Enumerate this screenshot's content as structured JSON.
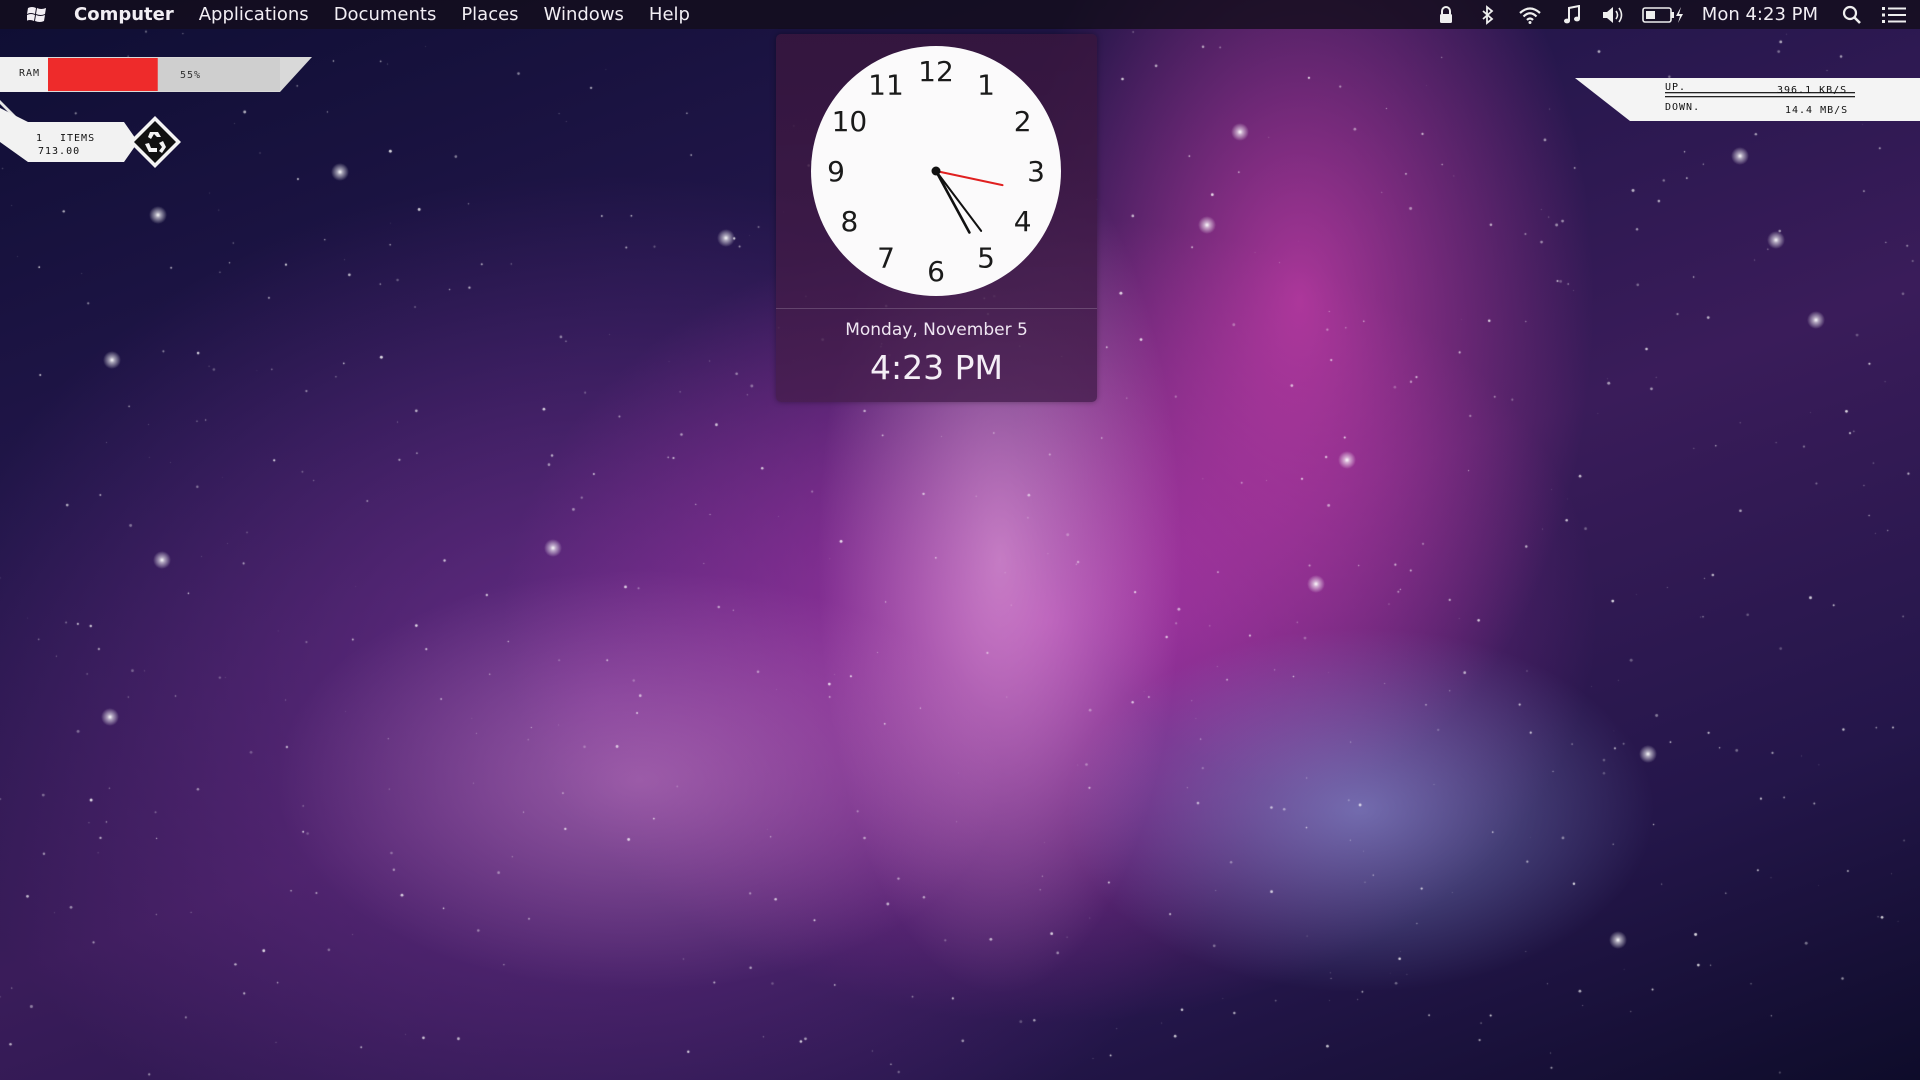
{
  "menubar": {
    "logo": "windows-logo",
    "items": [
      {
        "label": "Computer",
        "bold": true
      },
      {
        "label": "Applications",
        "bold": false
      },
      {
        "label": "Documents",
        "bold": false
      },
      {
        "label": "Places",
        "bold": false
      },
      {
        "label": "Windows",
        "bold": false
      },
      {
        "label": "Help",
        "bold": false
      }
    ],
    "tray_icons": [
      "lock-icon",
      "bluetooth-icon",
      "wifi-icon",
      "music-icon",
      "volume-icon",
      "battery-charging-icon"
    ],
    "clock": "Mon 4:23 PM",
    "right_icons": [
      "search-icon",
      "list-icon"
    ]
  },
  "ram_widget": {
    "label": "RAM",
    "percent_text": "55%",
    "usage": 55,
    "fill_color": "#ee2b2b"
  },
  "recycle_widget": {
    "count": "1",
    "items_label": "ITEMS",
    "size": "713.00",
    "icon": "recycle-icon"
  },
  "net_widget": {
    "up_label": "UP.",
    "up_value": "396.1 KB/S",
    "down_label": "DOWN.",
    "down_value": "14.4 MB/S"
  },
  "clock_widget": {
    "numbers": [
      "12",
      "1",
      "2",
      "3",
      "4",
      "5",
      "6",
      "7",
      "8",
      "9",
      "10",
      "11"
    ],
    "date": "Monday, November 5",
    "time": "4:23 PM",
    "hour": 4,
    "minute": 23,
    "second": 17,
    "second_hand_color": "#e02020"
  }
}
